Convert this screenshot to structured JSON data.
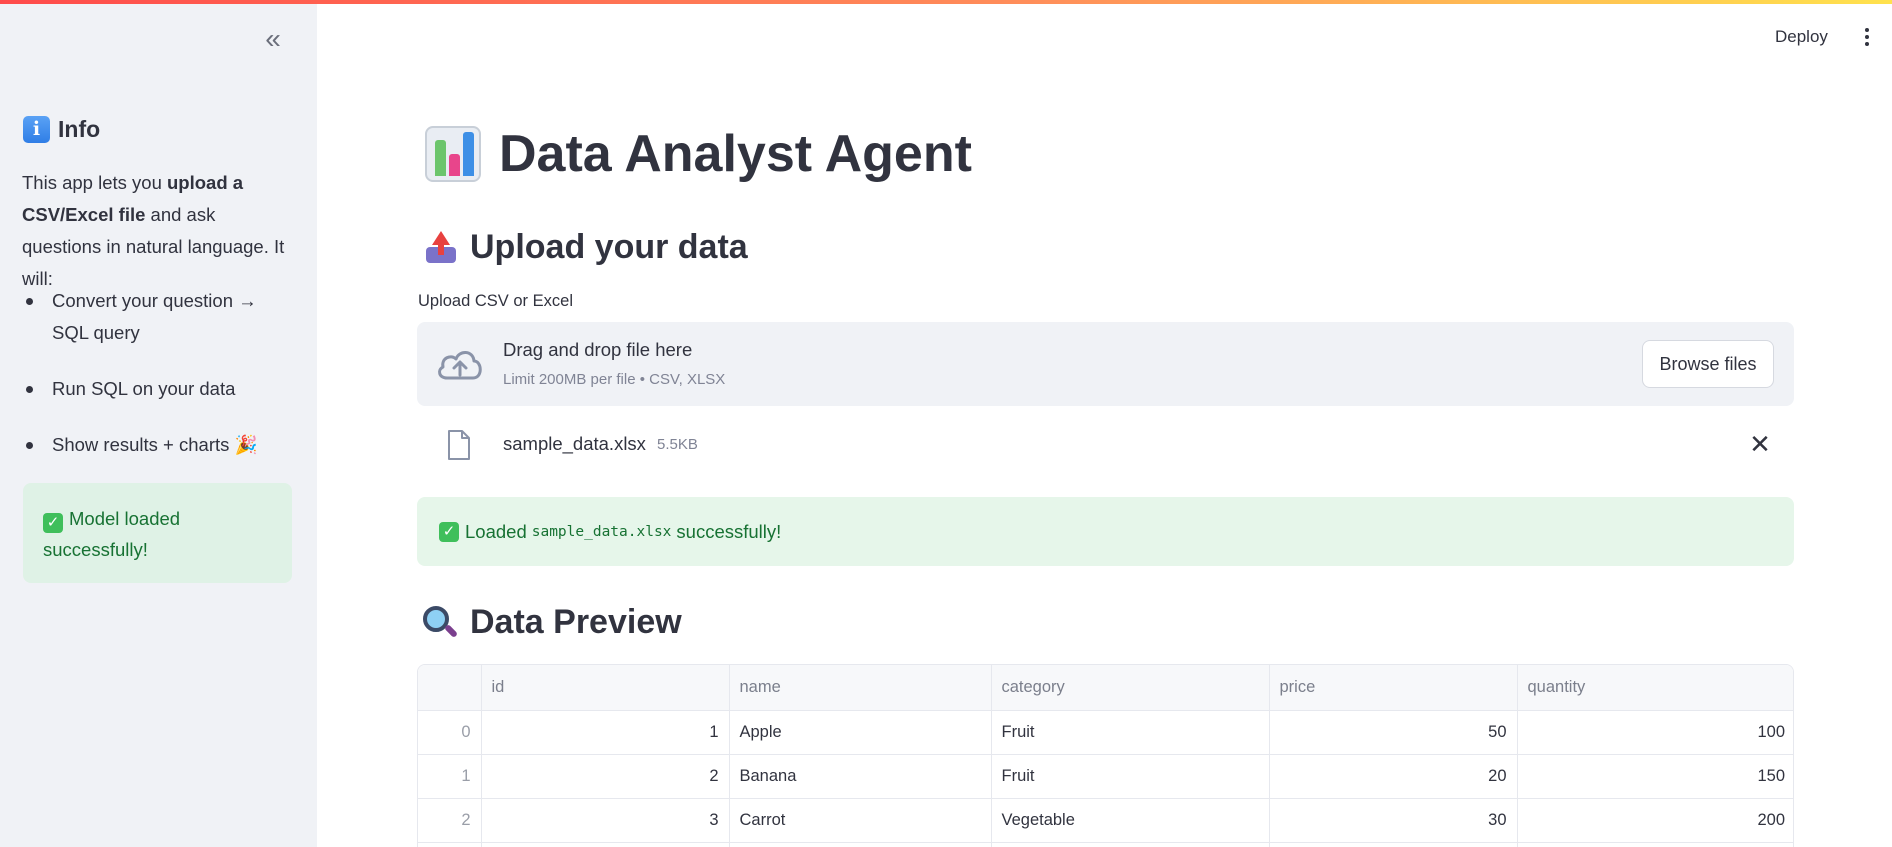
{
  "sidebar": {
    "collapse_glyph": "«",
    "heading": "Info",
    "intro": {
      "prefix": "This app lets you ",
      "bold": "upload a CSV/Excel file",
      "suffix": " and ask questions in natural language. It will:"
    },
    "items": [
      {
        "label": "Convert your question → SQL query"
      },
      {
        "label": "Run SQL on your data"
      },
      {
        "label": "Show results + charts 🎉"
      }
    ],
    "status": "Model loaded successfully!"
  },
  "header": {
    "deploy_label": "Deploy"
  },
  "main": {
    "title": "Data Analyst Agent",
    "upload_section": {
      "heading": "Upload your data",
      "field_label": "Upload CSV or Excel",
      "dropzone_title": "Drag and drop file here",
      "dropzone_limit": "Limit 200MB per file • CSV, XLSX",
      "browse_label": "Browse files"
    },
    "uploaded_file": {
      "name": "sample_data.xlsx",
      "size": "5.5KB"
    },
    "success": {
      "prefix": "Loaded",
      "filename": "sample_data.xlsx",
      "suffix": "successfully!"
    },
    "preview": {
      "heading": "Data Preview",
      "columns": [
        "",
        "id",
        "name",
        "category",
        "price",
        "quantity"
      ],
      "rows": [
        [
          "0",
          "1",
          "Apple",
          "Fruit",
          "50",
          "100"
        ],
        [
          "1",
          "2",
          "Banana",
          "Fruit",
          "20",
          "150"
        ],
        [
          "2",
          "3",
          "Carrot",
          "Vegetable",
          "30",
          "200"
        ],
        [
          "",
          "",
          "",
          "",
          "",
          ""
        ]
      ]
    }
  },
  "colors": {
    "sidebar_bg": "#f0f2f6",
    "success_green": "#177233",
    "text": "#31333f"
  }
}
